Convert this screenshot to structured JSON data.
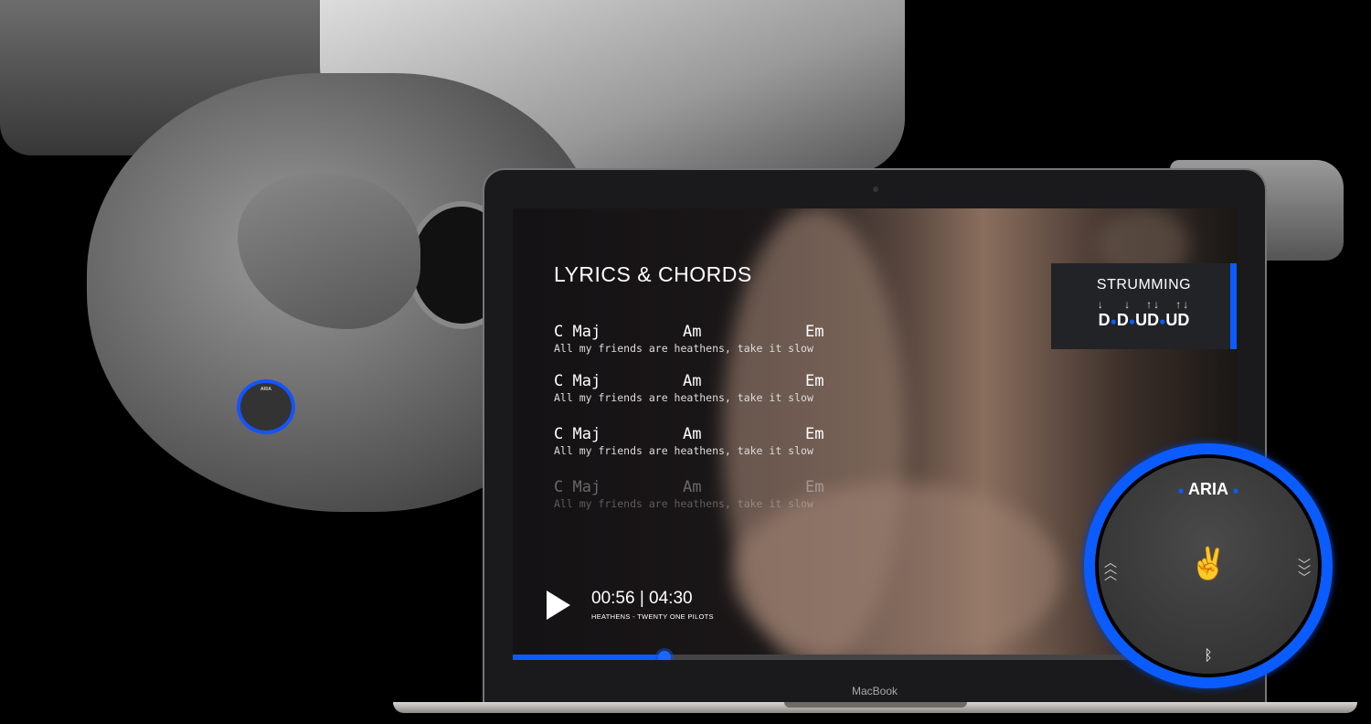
{
  "laptop": {
    "brand": "MacBook"
  },
  "player": {
    "title": "LYRICS & CHORDS",
    "lines": [
      {
        "chords": [
          "C Maj",
          "Am",
          "Em"
        ],
        "lyric": "All my friends are heathens, take it slow"
      },
      {
        "chords": [
          "C Maj",
          "Am",
          "Em"
        ],
        "lyric": "All my friends are heathens, take it slow"
      },
      {
        "chords": [
          "C Maj",
          "Am",
          "Em"
        ],
        "lyric": "All my friends are heathens, take it slow"
      },
      {
        "chords": [
          "C Maj",
          "Am",
          "Em"
        ],
        "lyric": "All my friends are heathens, take it slow"
      }
    ],
    "strumming": {
      "title": "STRUMMING",
      "arrows": [
        "↓",
        "↓",
        "↑↓",
        "↑↓"
      ],
      "pattern": [
        "D",
        "D",
        "UD",
        "UD"
      ]
    },
    "time": "00:56 | 04:30",
    "song": "HEATHENS - TWENTY ONE PILOTS",
    "progress_percent": 21,
    "accent": "#0a5cff"
  },
  "device": {
    "label": "ARIA",
    "icons": [
      "chevron-up-icon",
      "two-finger-gesture-icon",
      "chevron-down-icon",
      "bluetooth-icon"
    ]
  },
  "mini_device": {
    "label": "ARIA"
  }
}
